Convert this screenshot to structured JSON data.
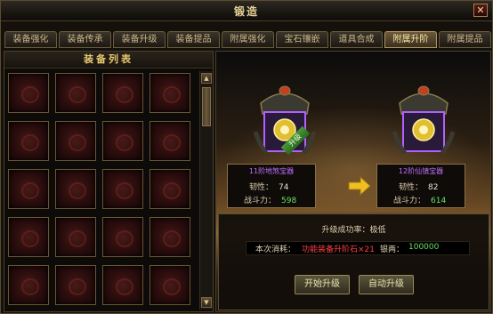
{
  "window": {
    "title": "锻造",
    "close_glyph": "✕"
  },
  "tabs": [
    {
      "label": "装备强化",
      "active": false
    },
    {
      "label": "装备传承",
      "active": false
    },
    {
      "label": "装备升级",
      "active": false
    },
    {
      "label": "装备提品",
      "active": false
    },
    {
      "label": "附属强化",
      "active": false
    },
    {
      "label": "宝石镶嵌",
      "active": false
    },
    {
      "label": "道具合成",
      "active": false
    },
    {
      "label": "附属升阶",
      "active": true
    },
    {
      "label": "附属提品",
      "active": false
    }
  ],
  "equipment_list": {
    "header": "装备列表",
    "slot_count": 20,
    "scroll_up": "▲",
    "scroll_down": "▼"
  },
  "upgrade": {
    "badge": "升级",
    "current": {
      "name": "11阶地煞宝器",
      "toughness_label": "韧性：",
      "toughness_value": "74",
      "power_label": "战斗力：",
      "power_value": "598"
    },
    "next": {
      "name": "12阶仙镇宝器",
      "toughness_label": "韧性：",
      "toughness_value": "82",
      "power_label": "战斗力：",
      "power_value": "614"
    },
    "success_rate": "升级成功率：极低",
    "cost_label": "本次消耗：",
    "cost_value": "功能装备升阶石×21",
    "silver_label": "银两：",
    "silver_value": "100000",
    "buttons": {
      "start": "开始升级",
      "auto": "自动升级"
    }
  },
  "colors": {
    "accent": "#e8c870",
    "purple_name": "#c070ff",
    "green_value": "#6ae060",
    "red_cost": "#ff4040"
  }
}
